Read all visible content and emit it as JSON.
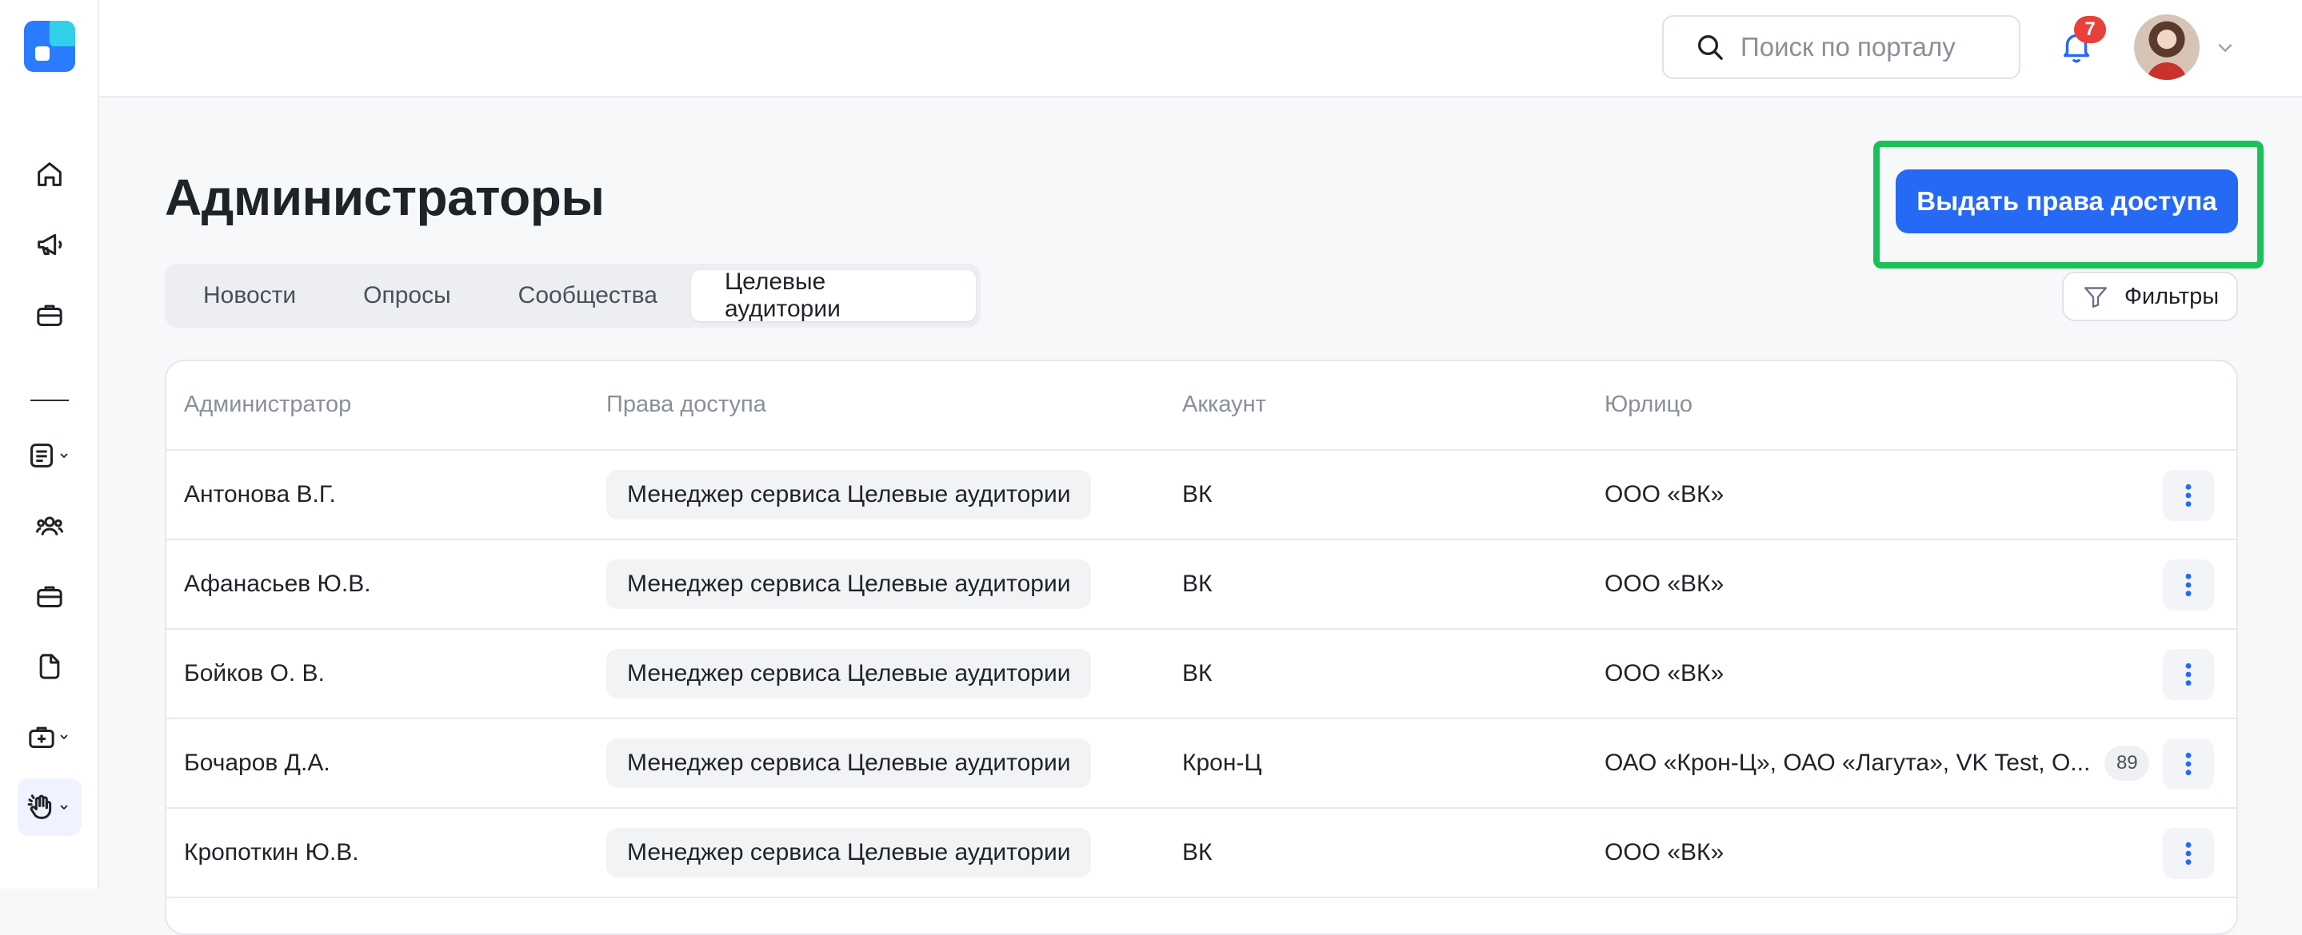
{
  "app": {
    "accent_color": "#2669f5",
    "highlight_color": "#1cc05a"
  },
  "sidebar": {
    "items": [
      {
        "icon": "home-icon"
      },
      {
        "icon": "megaphone-icon"
      },
      {
        "icon": "briefcase-icon"
      },
      {
        "icon": "document-list-icon",
        "has_dropdown": true
      },
      {
        "icon": "users-icon"
      },
      {
        "icon": "briefcase-icon"
      },
      {
        "icon": "file-icon"
      },
      {
        "icon": "medkit-icon",
        "has_dropdown": true
      },
      {
        "icon": "hand-wave-icon",
        "has_dropdown": true,
        "active": true
      }
    ]
  },
  "topbar": {
    "search_placeholder": "Поиск по порталу",
    "notifications_count": "7"
  },
  "page": {
    "title": "Администраторы",
    "primary_action": "Выдать права доступа",
    "filters_label": "Фильтры"
  },
  "tabs": [
    {
      "label": "Новости",
      "active": false
    },
    {
      "label": "Опросы",
      "active": false
    },
    {
      "label": "Сообщества",
      "active": false
    },
    {
      "label": "Целевые аудитории",
      "active": true
    }
  ],
  "table": {
    "columns": [
      "Администратор",
      "Права доступа",
      "Аккаунт",
      "Юрлицо"
    ],
    "rows": [
      {
        "admin": "Антонова В.Г.",
        "rights": "Менеджер сервиса Целевые аудитории",
        "account": "ВК",
        "entity": "ООО «ВК»",
        "extra": ""
      },
      {
        "admin": "Афанасьев  Ю.В.",
        "rights": "Менеджер сервиса Целевые аудитории",
        "account": "ВК",
        "entity": "ООО «ВК»",
        "extra": ""
      },
      {
        "admin": "Бойков О. В.",
        "rights": "Менеджер сервиса Целевые аудитории",
        "account": "ВК",
        "entity": "ООО «ВК»",
        "extra": ""
      },
      {
        "admin": "Бочаров Д.А.",
        "rights": "Менеджер сервиса Целевые аудитории",
        "account": "Крон-Ц",
        "entity": "ОАО «Крон-Ц», ОАО «Лагута», VK Test, О...",
        "extra": "89"
      },
      {
        "admin": "Кропоткин Ю.В.",
        "rights": "Менеджер сервиса Целевые аудитории",
        "account": "ВК",
        "entity": "ООО «ВК»",
        "extra": ""
      }
    ]
  }
}
